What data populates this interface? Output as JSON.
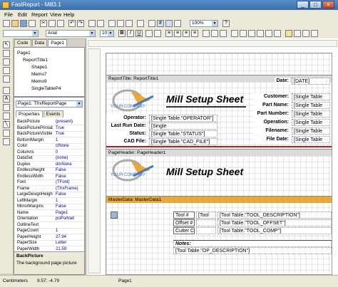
{
  "window": {
    "title": "FastReport - Mill3.1"
  },
  "menu": [
    "File",
    "Edit",
    "Report",
    "View",
    "Help"
  ],
  "toolbar": {
    "font_name": "Arial",
    "font_size": "10",
    "zoom": "100%"
  },
  "left_tabs": [
    "Code",
    "Data",
    "Page1"
  ],
  "tree": [
    "Page1",
    "ReportTitle1",
    "Shape1",
    "Memo7",
    "Memo9",
    "SingleTableP4"
  ],
  "object_selector": "Page1: TfrxReportPage",
  "props_tabs": [
    "Properties",
    "Events"
  ],
  "properties": [
    {
      "n": "BackPicture",
      "v": "(present)"
    },
    {
      "n": "BackPicturePrintable",
      "v": "True"
    },
    {
      "n": "BackPictureVisible",
      "v": "True"
    },
    {
      "n": "BottomMargin",
      "v": "1"
    },
    {
      "n": "Color",
      "v": "clNone"
    },
    {
      "n": "Columns",
      "v": "0"
    },
    {
      "n": "DataSet",
      "v": "(none)"
    },
    {
      "n": "Duplex",
      "v": "dmNone"
    },
    {
      "n": "EndlessHeight",
      "v": "False"
    },
    {
      "n": "EndlessWidth",
      "v": "False"
    },
    {
      "n": "Font",
      "v": "(TFont)"
    },
    {
      "n": "Frame",
      "v": "(TfrxFrame)"
    },
    {
      "n": "LargeDesignHeight",
      "v": "False"
    },
    {
      "n": "LeftMargin",
      "v": "1"
    },
    {
      "n": "MirrorMargins",
      "v": "False"
    },
    {
      "n": "Name",
      "v": "Page1"
    },
    {
      "n": "Orientation",
      "v": "poPortrait"
    },
    {
      "n": "OutlineText",
      "v": ""
    },
    {
      "n": "PageCount",
      "v": "1"
    },
    {
      "n": "PaperHeight",
      "v": "27.94"
    },
    {
      "n": "PaperSize",
      "v": "Letter"
    },
    {
      "n": "PaperWidth",
      "v": "21.59"
    }
  ],
  "prop_help": {
    "title": "BackPicture",
    "text": "The background page picture"
  },
  "report": {
    "title_band": "ReportTitle: ReportTitle1",
    "page_header_band": "PageHeader: PageHeader1",
    "masterdata_band": "MasterData: MasterData1",
    "heading": "Mill Setup Sheet",
    "logo_text": "YOUR COMPANY",
    "date_label": "Date:",
    "date_value": "[DATE]",
    "left_fields": [
      {
        "label": "Operator:",
        "value": "[Single Table.\"OPERATOR\"]"
      },
      {
        "label": "Last Run Date:",
        "value": "[Single"
      },
      {
        "label": "Status:",
        "value": "[Single Table.\"STATUS\"]"
      },
      {
        "label": "CAD File:",
        "value": "[Single Table.\"CAD_FILE\"]"
      }
    ],
    "right_fields": [
      {
        "label": "Customer:",
        "value": "[Single Table"
      },
      {
        "label": "Part Name:",
        "value": "[Single Table"
      },
      {
        "label": "Part Number:",
        "value": "[Single Table"
      },
      {
        "label": "Operation:",
        "value": "[Single Table"
      },
      {
        "label": "Filename:",
        "value": "[Single Table"
      },
      {
        "label": "File Date:",
        "value": "[Single Table"
      }
    ],
    "tool_rows": [
      {
        "label": "Tool #",
        "value": "[Tool",
        "extra": "[Tool Table.\"TOOL_DESCRIPTION\"]"
      },
      {
        "label": "Offset #",
        "value": "",
        "extra": "[Tool Table.\"TOOL_OFFSET\"]"
      },
      {
        "label": "Cutter Comp",
        "value": "",
        "extra": "[Tool Table.\"TOOL_COMP\"]"
      }
    ],
    "notes_label": "Notes:",
    "notes_value": "[Tool Table.\"OP_DESCRIPTION\"]"
  },
  "status": {
    "units": "Centimeters",
    "coords": "9.57; -4.79",
    "page": "Page1"
  },
  "colors": {
    "accent": "#3a6ea5",
    "band": "#e8a83a",
    "heading_rule": "#b01e1e"
  }
}
